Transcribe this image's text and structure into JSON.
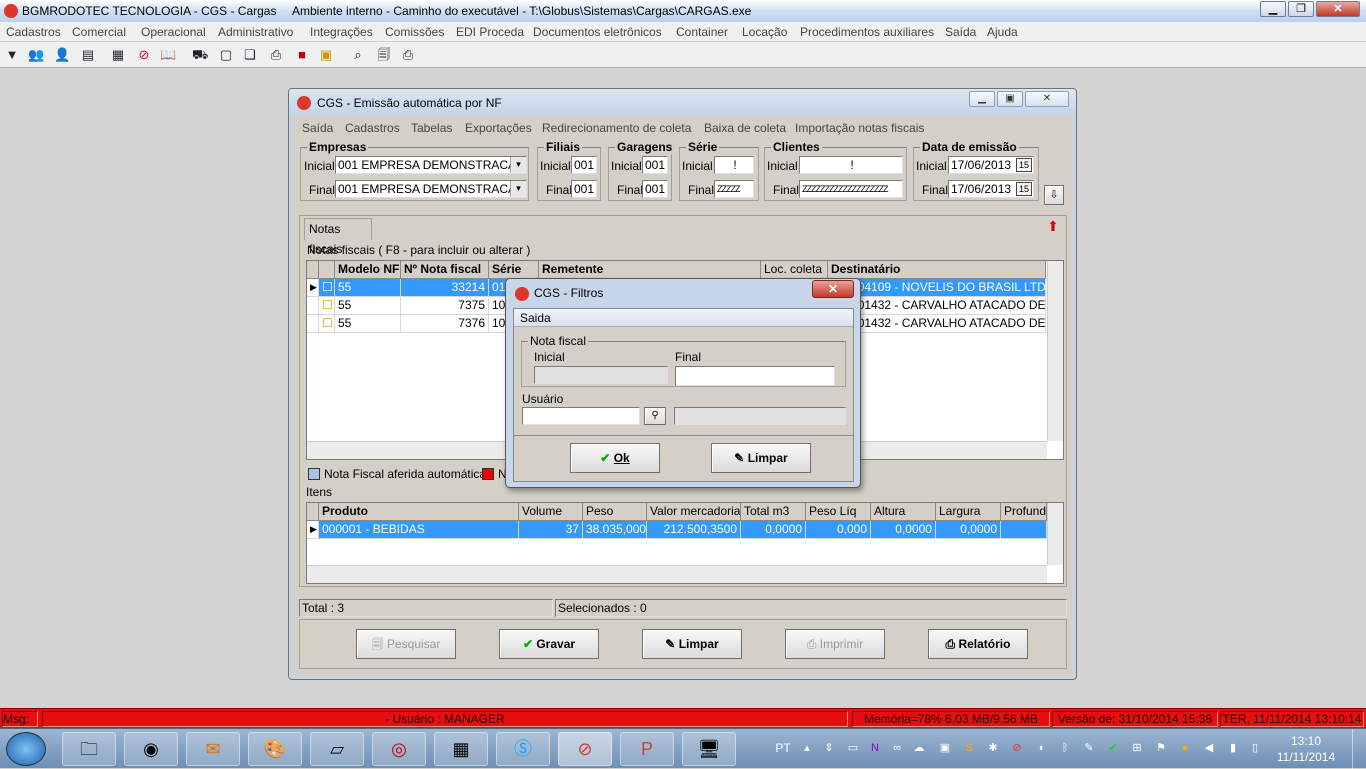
{
  "app": {
    "title": "BGMRODOTEC TECNOLOGIA - CGS - Cargas",
    "env": "Ambiente interno - Caminho do executável - T:\\Globus\\Sistemas\\Cargas\\CARGAS.exe"
  },
  "main_menu": [
    "Cadastros",
    "Comercial",
    "Operacional",
    "Administrativo",
    "Integrações",
    "Comissões",
    "EDI Proceda",
    "Documentos eletrônicos",
    "Container",
    "Locação",
    "Procedimentos auxiliares",
    "Saída",
    "Ajuda"
  ],
  "window": {
    "title": "CGS - Emissão automática por NF",
    "menu": [
      "Saída",
      "Cadastros",
      "Tabelas",
      "Exportações",
      "Redirecionamento de coleta",
      "Baixa de coleta",
      "Importação notas fiscais"
    ],
    "filters": {
      "empresas": {
        "label": "Empresas",
        "inicial_label": "Inicial",
        "final_label": "Final",
        "inicial": "001 EMPRESA DEMONSTRACAO",
        "final": "001 EMPRESA DEMONSTRACAO"
      },
      "filiais": {
        "label": "Filiais",
        "inicial_label": "Inicial",
        "final_label": "Final",
        "inicial": "001",
        "final": "001"
      },
      "garagens": {
        "label": "Garagens",
        "inicial_label": "Inicial",
        "final_label": "Final",
        "inicial": "001",
        "final": "001"
      },
      "serie": {
        "label": "Série",
        "inicial_label": "Inicial",
        "final_label": "Final",
        "inicial": "!",
        "final": "ZZZZZ"
      },
      "clientes": {
        "label": "Clientes",
        "inicial_label": "Inicial",
        "final_label": "Final",
        "inicial": "!",
        "final": "ZZZZZZZZZZZZZZZZZZZ"
      },
      "data": {
        "label": "Data de emissão",
        "inicial_label": "Inicial",
        "final_label": "Final",
        "inicial": "17/06/2013",
        "final": "17/06/2013",
        "cal": "15"
      }
    },
    "tab": "Notas fiscais",
    "grid_caption": "Notas fiscais ( F8 - para incluir ou alterar )",
    "grid_headers": [
      "Modelo NF",
      "Nº Nota fiscal",
      "Série",
      "Remetente",
      "Loc. coleta",
      "Destinatário"
    ],
    "rows": [
      {
        "modelo": "55",
        "nota": "33214",
        "serie": "01",
        "dest": "300004109 - NOVELIS DO BRASIL LTDA"
      },
      {
        "modelo": "55",
        "nota": "7375",
        "serie": "10",
        "dest": "523001432 - CARVALHO ATACADO DE"
      },
      {
        "modelo": "55",
        "nota": "7376",
        "serie": "10",
        "dest": "523001432 - CARVALHO ATACADO DE"
      }
    ],
    "legend": {
      "a": "Nota Fiscal aferida automática",
      "b": "N"
    },
    "items_label": "Itens",
    "items_headers": [
      "Produto",
      "Volume",
      "Peso",
      "Valor mercadoria",
      "Total m3",
      "Peso Líq",
      "Altura",
      "Largura",
      "Profundi"
    ],
    "items_rows": [
      {
        "produto": "000001 - BEBIDAS",
        "volume": "37",
        "peso": "38.035,000",
        "valor": "212.500,3500",
        "m3": "0,0000",
        "pliq": "0,000",
        "altura": "0,0000",
        "largura": "0,0000"
      }
    ],
    "total": "Total : 3",
    "selecionados": "Selecionados : 0",
    "buttons": {
      "pesquisar": "Pesquisar",
      "gravar": "Gravar",
      "limpar": "Limpar",
      "imprimir": "Imprimir",
      "relatorio": "Relatório"
    }
  },
  "dialog": {
    "title": "CGS - Filtros",
    "menu": "Saida",
    "group": "Nota fiscal",
    "inicial": "Inicial",
    "final": "Final",
    "usuario": "Usuário",
    "ok": "Ok",
    "limpar": "Limpar"
  },
  "status": {
    "msg": "Msg:",
    "usuario": "- Usuário : MANAGER",
    "memoria": "Memória=78% 6,03 MB/9,56 MB",
    "versao": "Versão de: 31/10/2014 15:38",
    "data": "TER, 11/11/2014 13:10:14"
  },
  "tray": {
    "lang": "PT",
    "time": "13:10",
    "date": "11/11/2014"
  },
  "colors": {
    "selection": "#3399ff",
    "status_bar": "#e41010",
    "mdi_bg": "#d3d3d3"
  }
}
